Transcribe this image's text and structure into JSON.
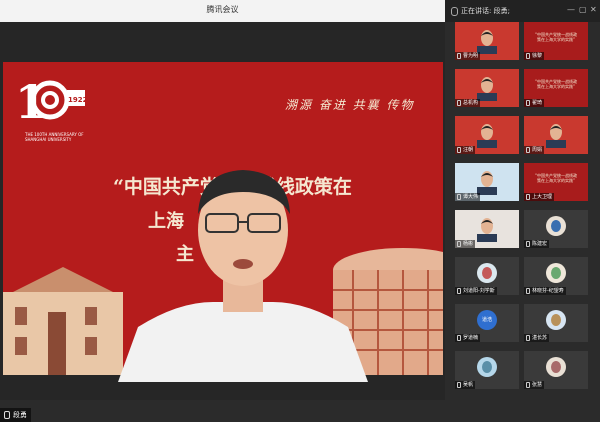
{
  "window": {
    "title": "腾讯会议"
  },
  "sidebar_header": {
    "speaking_label": "正在讲话: 段勇;"
  },
  "slide": {
    "logo_year": "1922",
    "logo_caption": "THE 100TH ANNIVERSARY OF SHANGHAI UNIVERSITY",
    "slogan": "溯源 奋进 共襄 传物",
    "headline_line1": "“中国共产党统一战线政策在",
    "headline_line2": "上海",
    "headline_line3": "主"
  },
  "speaker": {
    "name": "段勇"
  },
  "participants": [
    {
      "name": "曹为明",
      "kind": "video"
    },
    {
      "name": "徐黎",
      "kind": "slide",
      "slide_text": "“中国共产党统一战线政策在上海大学的实践”"
    },
    {
      "name": "总机构",
      "kind": "video"
    },
    {
      "name": "翟琦",
      "kind": "slide",
      "slide_text": "“中国共产党统一战线政策在上海大学的实践”"
    },
    {
      "name": "汪朝",
      "kind": "video"
    },
    {
      "name": "周娟",
      "kind": "video"
    },
    {
      "name": "谭大伟",
      "kind": "video"
    },
    {
      "name": "上大卫理",
      "kind": "slide",
      "slide_text": "“中国共产党统一战线政策在上海大学的实践”"
    },
    {
      "name": "杨彬",
      "kind": "video"
    },
    {
      "name": "陈建宏",
      "kind": "avatar"
    },
    {
      "name": "刘道阳-刘学斯",
      "kind": "avatar"
    },
    {
      "name": "林晓芬-纪望寿",
      "kind": "avatar"
    },
    {
      "name": "罗道楠",
      "kind": "avatar",
      "avatar_text": "道浩"
    },
    {
      "name": "湛长苏",
      "kind": "avatar"
    },
    {
      "name": "吴帆",
      "kind": "avatar"
    },
    {
      "name": "张慧",
      "kind": "avatar"
    }
  ]
}
